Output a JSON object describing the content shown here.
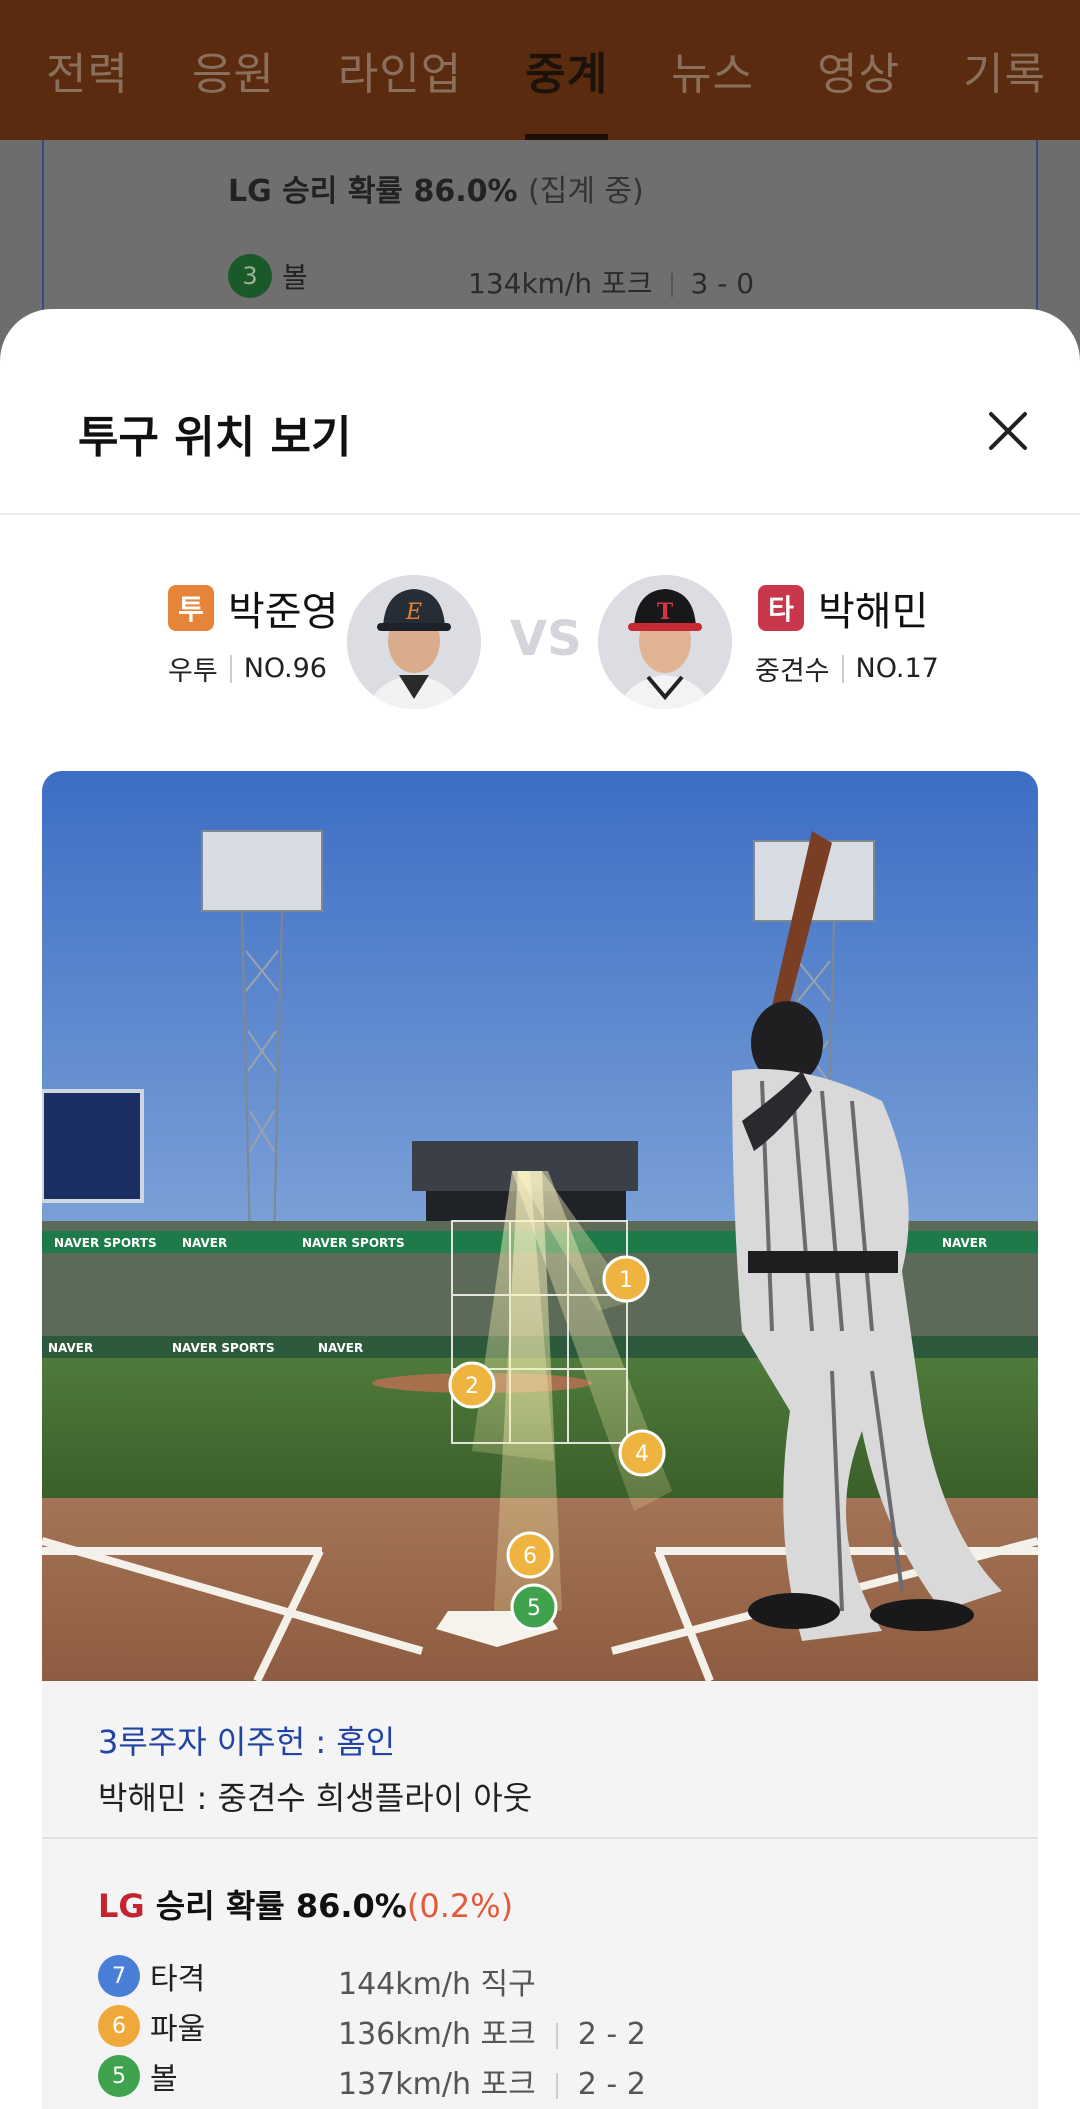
{
  "nav": {
    "tabs": [
      "전력",
      "응원",
      "라인업",
      "중계",
      "뉴스",
      "영상",
      "기록"
    ],
    "active_index": 3
  },
  "background_card": {
    "prob_main": "LG 승리 확률 86.0%",
    "prob_sub": "(집계 중)",
    "pitch": {
      "num": "3",
      "result": "볼",
      "speed_type": "134km/h  포크",
      "count": "3 - 0"
    }
  },
  "sheet": {
    "title": "투구 위치 보기",
    "pitcher": {
      "badge": "투",
      "name": "박준영",
      "position": "우투",
      "number": "NO.96",
      "badge_color": "#e6853a"
    },
    "vs": "VS",
    "batter": {
      "badge": "타",
      "name": "박해민",
      "position": "중견수",
      "number": "NO.17",
      "badge_color": "#c8374b"
    },
    "field": {
      "ads": [
        "NAVER",
        "NAVER SPORTS",
        "NAVER",
        "NAVER SPORTS",
        "NAVER",
        "NAVER SPORTS",
        "NAVER"
      ],
      "pitch_markers": [
        "1",
        "2",
        "4",
        "6",
        "5"
      ]
    },
    "result": {
      "runner": "3루주자 이주헌 : 홈인",
      "play": "박해민 : 중견수 희생플라이 아웃",
      "win_prob_team": "LG",
      "win_prob_text": " 승리 확률 86.0%",
      "win_prob_diff": "(0.2%)",
      "pitches": [
        {
          "num": "7",
          "result": "타격",
          "speed_type": "144km/h  직구",
          "count": "",
          "color": "#4a7fd8"
        },
        {
          "num": "6",
          "result": "파울",
          "speed_type": "136km/h  포크",
          "count": "2 - 2",
          "color": "#efa93b"
        },
        {
          "num": "5",
          "result": "볼",
          "speed_type": "137km/h  포크",
          "count": "2 - 2",
          "color": "#3fa34d"
        }
      ]
    }
  }
}
